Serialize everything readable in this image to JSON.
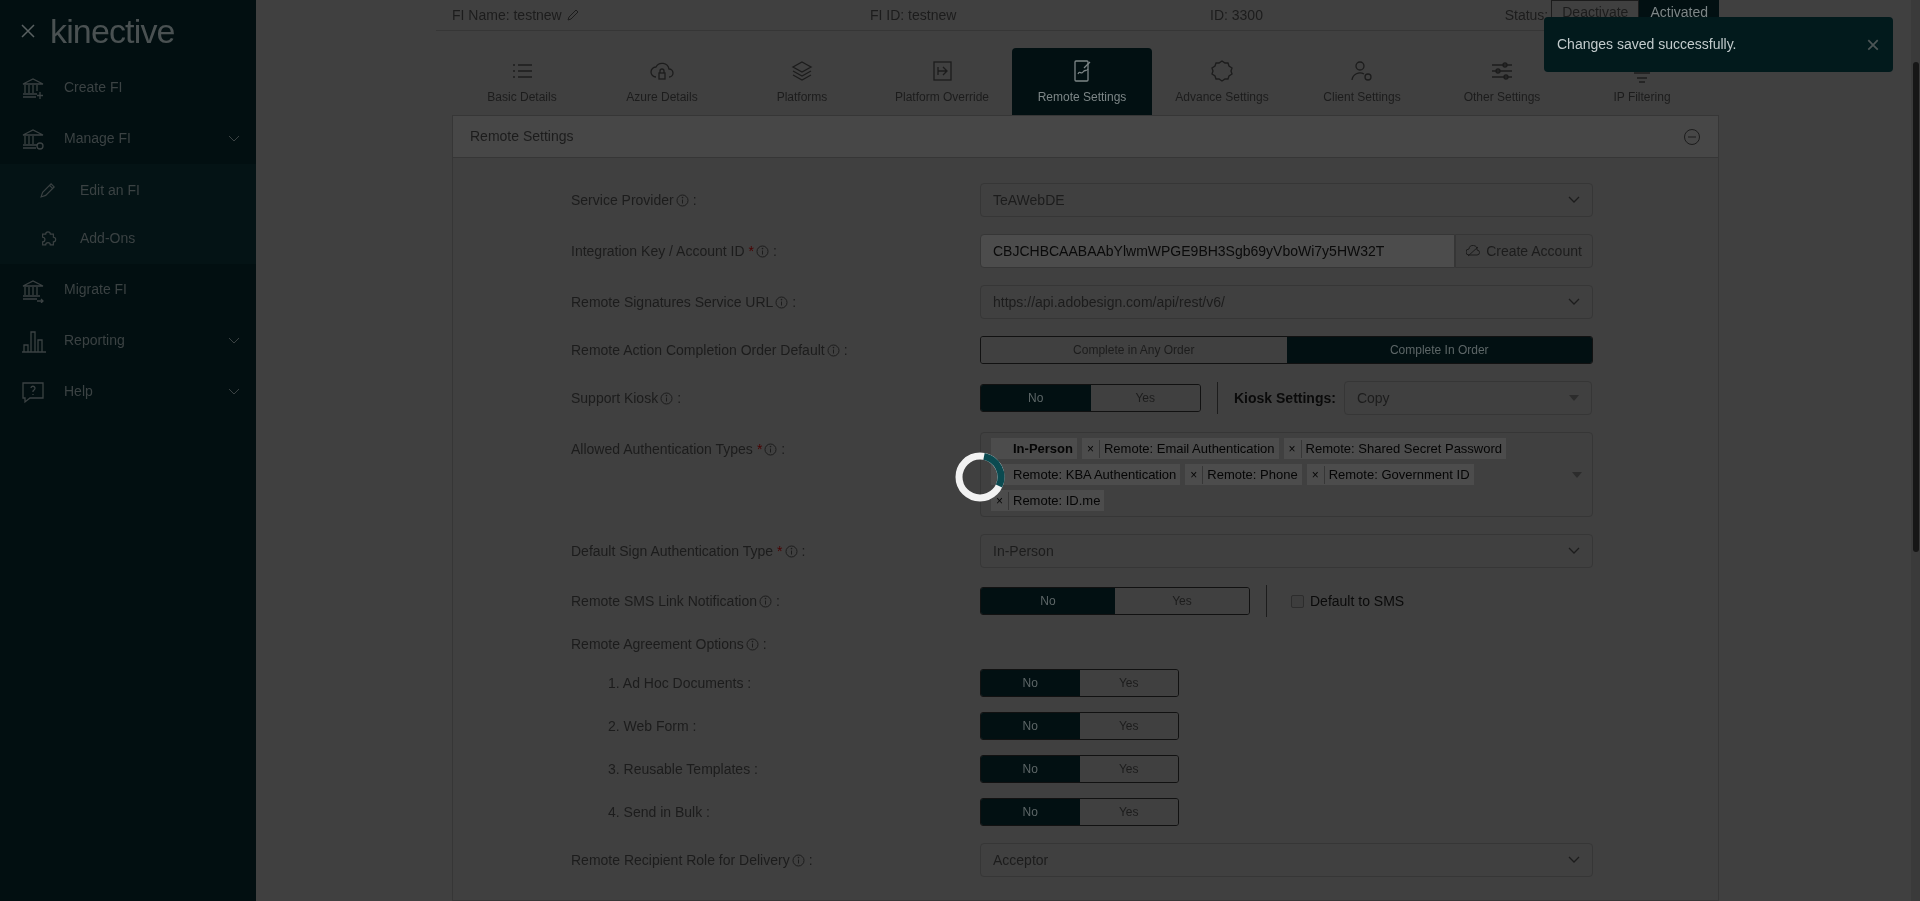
{
  "sidebar": {
    "logo": "kinective",
    "items": [
      {
        "label": "Create FI",
        "expandable": false
      },
      {
        "label": "Manage FI",
        "expandable": true,
        "children": [
          {
            "label": "Edit an FI"
          },
          {
            "label": "Add-Ons"
          }
        ]
      },
      {
        "label": "Migrate FI",
        "expandable": false
      },
      {
        "label": "Reporting",
        "expandable": true
      },
      {
        "label": "Help",
        "expandable": true
      }
    ]
  },
  "header": {
    "fi_name": "FI Name: testnew",
    "fi_id": "FI ID: testnew",
    "id": "ID: 3300",
    "status_label": "Status:",
    "status_options": [
      {
        "label": "Deactivate",
        "selected": false
      },
      {
        "label": "Activated",
        "selected": true
      }
    ]
  },
  "tabs": [
    {
      "label": "Basic Details",
      "selected": false
    },
    {
      "label": "Azure Details",
      "selected": false
    },
    {
      "label": "Platforms",
      "selected": false
    },
    {
      "label": "Platform Override",
      "selected": false
    },
    {
      "label": "Remote Settings",
      "selected": true
    },
    {
      "label": "Advance Settings",
      "selected": false
    },
    {
      "label": "Client Settings",
      "selected": false
    },
    {
      "label": "Other Settings",
      "selected": false
    },
    {
      "label": "IP Filtering",
      "selected": false
    }
  ],
  "section": {
    "title": "Remote Settings",
    "fields": [
      {
        "kind": "select",
        "label": "Service Provider",
        "after": ":",
        "value": "TeAWebDE"
      },
      {
        "kind": "key",
        "label": "Integration Key / Account ID",
        "required_mark": "*",
        "after": ":",
        "value": "CBJCHBCAABAAbYlwmWPGE9BH3Sgb69yVboWi7y5HW32T",
        "button": "Create Account"
      },
      {
        "kind": "select",
        "label": "Remote Signatures Service URL",
        "after": ":",
        "value": "https://api.adobesign.com/api/rest/v6/"
      },
      {
        "kind": "segmented",
        "label": "Remote Action Completion Order Default",
        "after": ":",
        "options": [
          {
            "label": "Complete in Any Order",
            "selected": false
          },
          {
            "label": "Complete In Order",
            "selected": true
          }
        ]
      },
      {
        "kind": "toggle",
        "label": "Support Kiosk",
        "after": ":",
        "options": [
          {
            "label": "No",
            "selected": true
          },
          {
            "label": "Yes",
            "selected": false
          }
        ],
        "extra": {
          "kind": "select",
          "label": "Kiosk Settings:",
          "value": "Copy"
        }
      },
      {
        "kind": "tags",
        "label": "Allowed Authentication Types",
        "required_mark": "*",
        "after": ":",
        "tags": [
          {
            "label": "In-Person"
          },
          {
            "label": "Remote: Email Authentication",
            "remove": "×"
          },
          {
            "label": "Remote: Shared Secret Password",
            "remove": "×"
          },
          {
            "label": "Remote: KBA Authentication"
          },
          {
            "label": "Remote: Phone",
            "remove": "×"
          },
          {
            "label": "Remote: Government ID",
            "remove": "×"
          },
          {
            "label": "Remote: ID.me",
            "remove": "×"
          }
        ]
      },
      {
        "kind": "select",
        "label": "Default Sign Authentication Type",
        "required_mark": "*",
        "after": ":",
        "value": "In-Person"
      },
      {
        "kind": "toggle",
        "label": "Remote SMS Link Notification",
        "after": ":",
        "options": [
          {
            "label": "No",
            "selected": true
          },
          {
            "label": "Yes",
            "selected": false
          }
        ],
        "extra": {
          "kind": "checkbox",
          "label": "Default to SMS",
          "checked": false
        }
      },
      {
        "kind": "group",
        "label": "Remote Agreement Options",
        "after": ":",
        "items": [
          {
            "label": "1. Ad Hoc Documents :",
            "options": [
              {
                "label": "No",
                "selected": true
              },
              {
                "label": "Yes",
                "selected": false
              }
            ]
          },
          {
            "label": "2. Web Form :",
            "options": [
              {
                "label": "No",
                "selected": true
              },
              {
                "label": "Yes",
                "selected": false
              }
            ]
          },
          {
            "label": "3. Reusable Templates :",
            "options": [
              {
                "label": "No",
                "selected": true
              },
              {
                "label": "Yes",
                "selected": false
              }
            ]
          },
          {
            "label": "4. Send in Bulk :",
            "options": [
              {
                "label": "No",
                "selected": true
              },
              {
                "label": "Yes",
                "selected": false
              }
            ]
          }
        ]
      },
      {
        "kind": "select",
        "label": "Remote Recipient Role for Delivery",
        "after": ":",
        "value": "Acceptor"
      }
    ]
  },
  "toast": {
    "message": "Changes saved successfully.",
    "close": "×"
  },
  "loading": true
}
